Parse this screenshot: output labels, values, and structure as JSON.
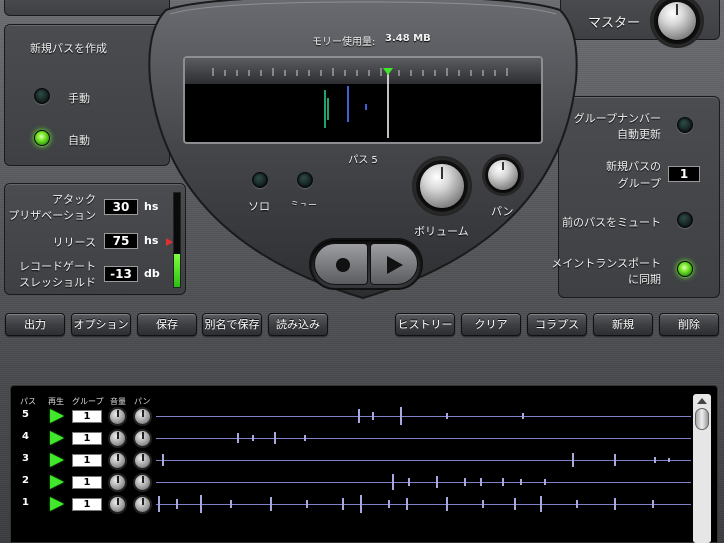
{
  "master": {
    "label": "マスター"
  },
  "memory": {
    "label": "モリー使用量:",
    "value": "3.48 MB"
  },
  "new_pass": {
    "title": "新規パスを作成",
    "manual": "手動",
    "auto": "自動"
  },
  "meter": {
    "pass_label": "パス 5"
  },
  "controls": {
    "solo": "ソロ",
    "mute": "ミュート",
    "volume": "ボリューム",
    "pan": "パン"
  },
  "settings": {
    "attack_line1": "アタック",
    "attack_line2": "プリザベーション",
    "attack_value": "30",
    "attack_unit": "hs",
    "release": "リリース",
    "release_value": "75",
    "release_unit": "hs",
    "gate_line1": "レコードゲート",
    "gate_line2": "スレッショルド",
    "gate_value": "-13",
    "gate_unit": "db",
    "input_level": 0.35
  },
  "right": {
    "group_auto_line1": "グループナンバー",
    "group_auto_line2": "自動更新",
    "new_pass_group_line1": "新規パスの",
    "new_pass_group_line2": "グループ",
    "group_value": "1",
    "mute_prev": "前のパスをミュート",
    "sync_line1": "メイントランスポート",
    "sync_line2": "に同期"
  },
  "toolbar": {
    "output": "出力",
    "options": "オプション",
    "save": "保存",
    "save_as": "別名で保存",
    "load": "読み込み",
    "history": "ヒストリー",
    "clear": "クリア",
    "collapse": "コラプス",
    "new": "新規",
    "delete": "削除"
  },
  "tracks_header": {
    "pass": "パス",
    "play": "再生",
    "group": "グループ",
    "volume": "音量",
    "pan": "パン"
  },
  "tracks": [
    {
      "num": "5",
      "group": "1"
    },
    {
      "num": "4",
      "group": "1"
    },
    {
      "num": "3",
      "group": "1"
    },
    {
      "num": "2",
      "group": "1"
    },
    {
      "num": "1",
      "group": "1"
    }
  ],
  "colors": {
    "led_on": "#6cff2a",
    "waveform": "#a8aadf",
    "playhead": "#3fe82a"
  }
}
